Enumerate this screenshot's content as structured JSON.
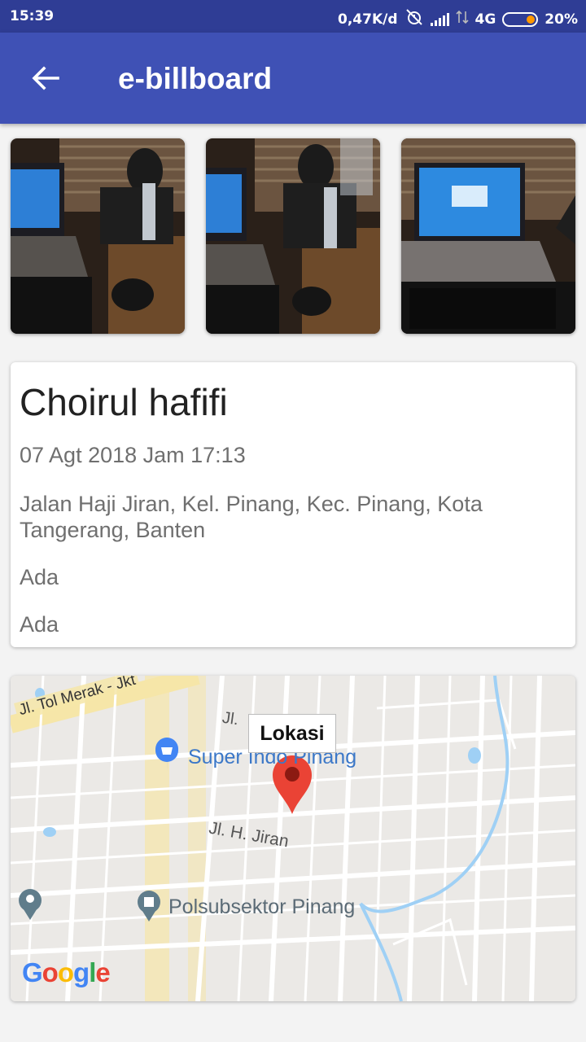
{
  "status_bar": {
    "time": "15:39",
    "net_speed": "0,47K/d",
    "network_type": "4G",
    "battery": "20%",
    "icons": [
      "alarm-off-icon",
      "signal-icon",
      "data-arrows-icon",
      "battery-icon"
    ]
  },
  "app_bar": {
    "title": "e-billboard",
    "back_icon": "arrow-left-icon"
  },
  "photos": [
    {
      "name": "photo-1"
    },
    {
      "name": "photo-2"
    },
    {
      "name": "photo-3"
    }
  ],
  "detail": {
    "name": "Choirul hafifi",
    "datetime": "07 Agt 2018 Jam 17:13",
    "address": "Jalan Haji Jiran, Kel. Pinang, Kec. Pinang, Kota Tangerang, Banten",
    "field_1": "Ada",
    "field_2": "Ada"
  },
  "map": {
    "marker_title": "Lokasi",
    "labels": {
      "toll_road": "Jl. Tol Merak - Jkt",
      "street_top": "Jl.",
      "poi_store": "Super Indo Pinang",
      "street_main": "Jl. H. Jiran",
      "poi_police": "Polsubsektor Pinang"
    },
    "attribution": "Google",
    "colors": {
      "marker": "#ea4335",
      "poi_store": "#4285f4",
      "poi_police": "#607d8b",
      "water": "#9fd0f5",
      "toll": "#f6e6a8"
    }
  }
}
